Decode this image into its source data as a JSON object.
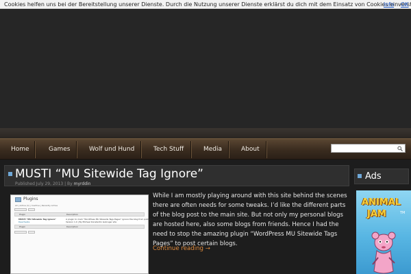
{
  "cookie_bar": {
    "text": "Cookies helfen uns bei der Bereitstellung unserer Dienste. Durch die Nutzung unserer Dienste erklärst du dich mit dem Einsatz von Cookies einverstanden.",
    "info_label": "Info",
    "ok_label": "OK"
  },
  "nav": {
    "items": [
      {
        "label": "Home"
      },
      {
        "label": "Games"
      },
      {
        "label": "Wolf und Hund"
      },
      {
        "label": "Tech Stuff"
      },
      {
        "label": "Media"
      },
      {
        "label": "About"
      }
    ],
    "search": {
      "value": "",
      "icon": "search-icon"
    }
  },
  "post": {
    "title": "MUSTI “MU Sitewide Tag Ignore”",
    "meta_prefix": "Published July 29, 2013 | By ",
    "author": "myrddin",
    "text": "While I am mostly playing around with this site behind the scenes there are often needs for some tweaks. I’d like the different parts of the blog post to the main site. But not only my personal blogs are hosted here, also some blogs from friends. Hence I had the need to stop the amazing plugin “WordPress MU Sitewide Tags Pages” to post certain blogs.",
    "continue_label": "Continue reading →",
    "thumbnail": {
      "title": "Plugins",
      "subnav": "All | Active (1) | Inactive | Recently Active",
      "bulk_label": "Bulk Actions",
      "apply_label": "Apply",
      "col_plugin": "Plugin",
      "col_description": "Description",
      "row_plugin_name": "MUSTI \"MU Sitewide Tag Ignore\"",
      "row_plugin_action": "Deactivate",
      "row_description": "A plugin to mark \"WordPress MU Sitewide Tags Pages\" ignore this blog from publishing on main site.",
      "row_version": "Version 1.0 | By Michael Konstantin Gsbruger site"
    }
  },
  "sidebar": {
    "ads_title": "Ads",
    "ad": {
      "line1": "ANIMAL",
      "line2": "JAM",
      "tm": "TM"
    }
  },
  "colors": {
    "accent": "#6fa8d8",
    "link": "#e08a3c",
    "nav_bg": "#3a2c1f"
  }
}
